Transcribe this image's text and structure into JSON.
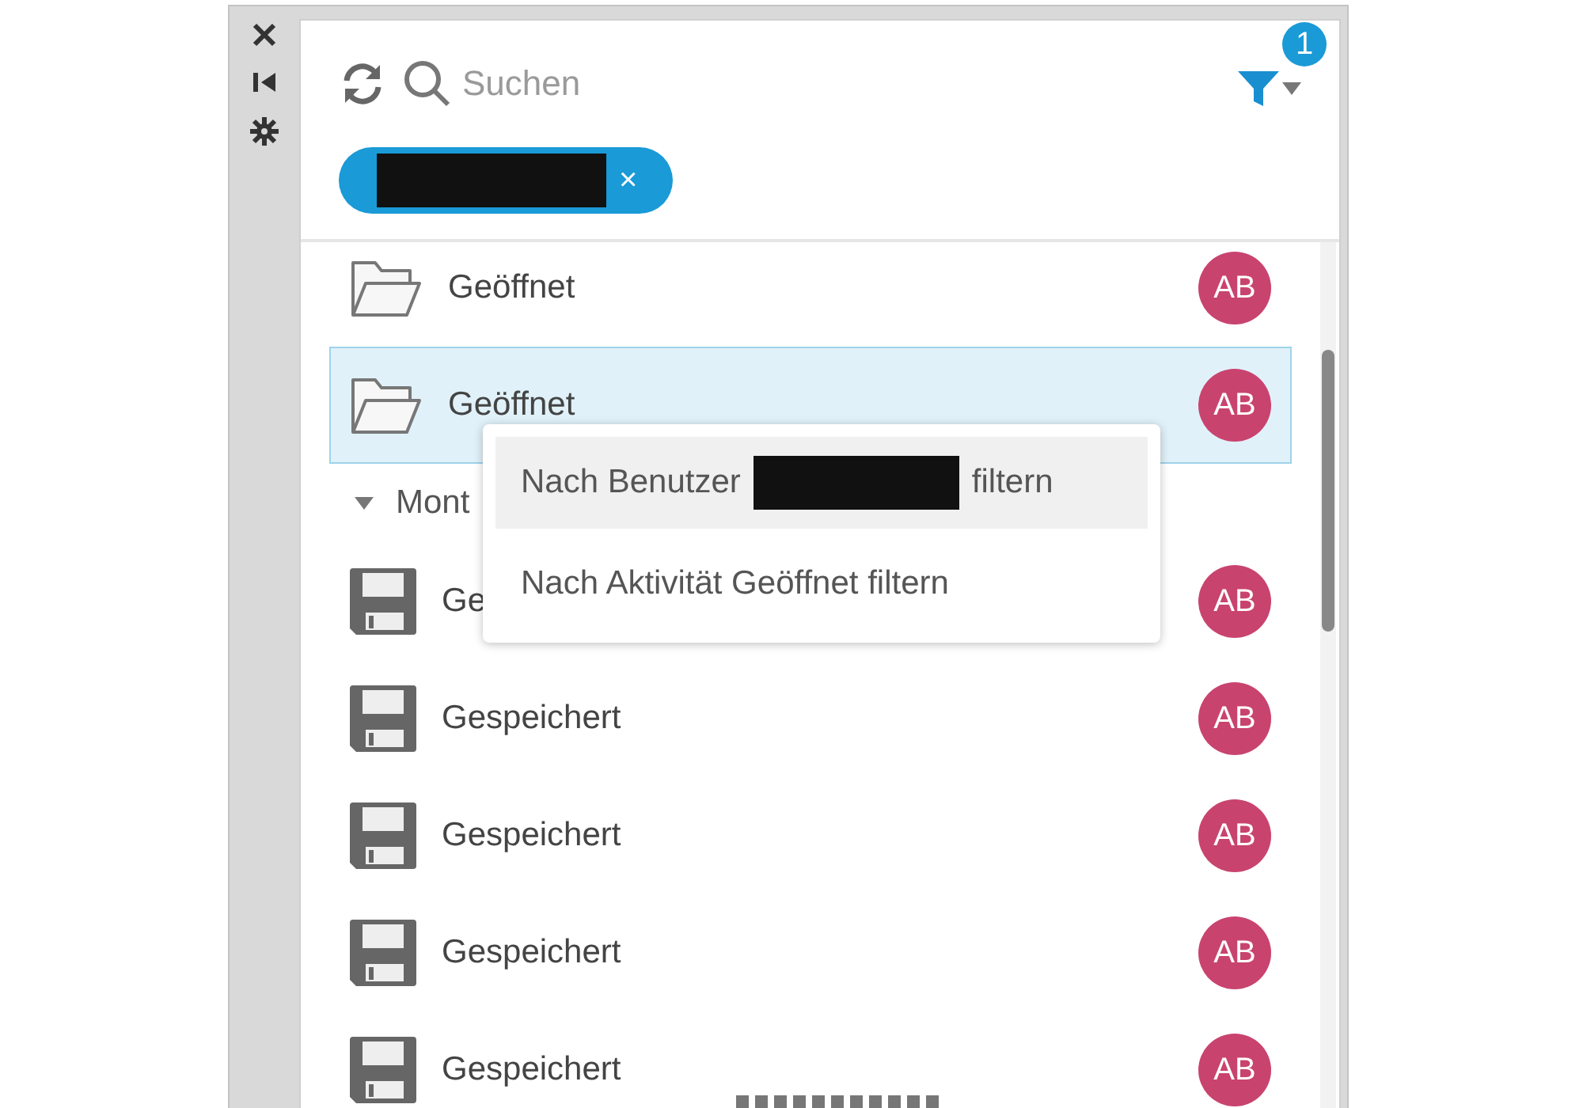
{
  "toolbar": {
    "search": {
      "placeholder": "Suchen"
    },
    "filter_badge": "1"
  },
  "filter_chips": [
    {
      "redacted": true,
      "remove": "×"
    }
  ],
  "activity_list": [
    {
      "kind": "opened",
      "label": "Geöffnet",
      "avatar": "AB",
      "selected": false
    },
    {
      "kind": "opened",
      "label": "Geöffnet",
      "avatar": "AB",
      "selected": true
    },
    {
      "kind": "group",
      "label": "Mont",
      "expanded": true
    },
    {
      "kind": "saved",
      "label": "Ge",
      "avatar": "AB",
      "selected": false
    },
    {
      "kind": "saved",
      "label": "Gespeichert",
      "avatar": "AB",
      "selected": false
    },
    {
      "kind": "saved",
      "label": "Gespeichert",
      "avatar": "AB",
      "selected": false
    },
    {
      "kind": "saved",
      "label": "Gespeichert",
      "avatar": "AB",
      "selected": false
    },
    {
      "kind": "saved",
      "label": "Gespeichert",
      "avatar": "AB",
      "selected": false
    }
  ],
  "context_menu": [
    {
      "before": "Nach Benutzer",
      "redacted": true,
      "after": "filtern",
      "highlighted": true
    },
    {
      "before": "Nach Aktivität Geöffnet filtern",
      "redacted": false,
      "highlighted": false
    }
  ]
}
